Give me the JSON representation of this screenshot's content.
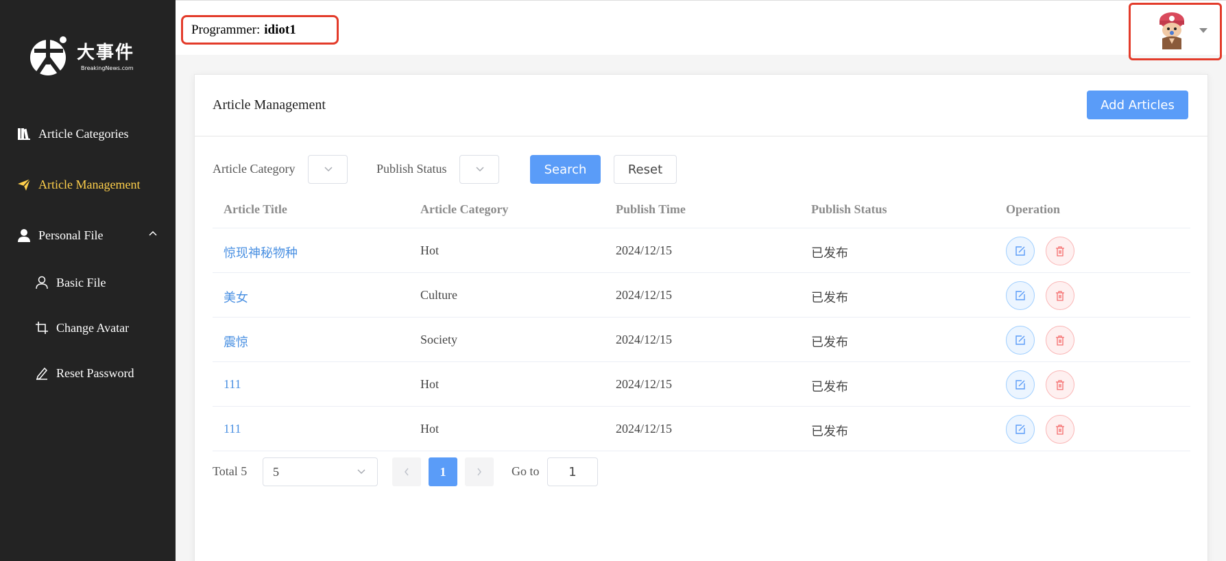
{
  "sidebar": {
    "logo": {
      "title": "大事件",
      "subtitle": "BreakingNews.com"
    },
    "items": [
      {
        "label": "Article Categories",
        "icon": "book-icon"
      },
      {
        "label": "Article Management",
        "icon": "send-icon",
        "active": true
      },
      {
        "label": "Personal File",
        "icon": "user-icon",
        "expanded": true
      },
      {
        "label": "Basic File",
        "icon": "user-outline-icon"
      },
      {
        "label": "Change Avatar",
        "icon": "crop-icon"
      },
      {
        "label": "Reset Password",
        "icon": "pen-icon"
      }
    ]
  },
  "header": {
    "programmer_label": "Programmer:",
    "programmer_name": "idiot1"
  },
  "card": {
    "title": "Article Management",
    "add_button": "Add Articles"
  },
  "filters": {
    "category_label": "Article Category",
    "status_label": "Publish Status",
    "search_button": "Search",
    "reset_button": "Reset"
  },
  "table": {
    "columns": [
      "Article Title",
      "Article Category",
      "Publish Time",
      "Publish Status",
      "Operation"
    ],
    "rows": [
      {
        "title": "惊现神秘物种",
        "category": "Hot",
        "time": "2024/12/15",
        "status": "已发布"
      },
      {
        "title": "美女",
        "category": "Culture",
        "time": "2024/12/15",
        "status": "已发布"
      },
      {
        "title": "震惊",
        "category": "Society",
        "time": "2024/12/15",
        "status": "已发布"
      },
      {
        "title": "111",
        "category": "Hot",
        "time": "2024/12/15",
        "status": "已发布"
      },
      {
        "title": "111",
        "category": "Hot",
        "time": "2024/12/15",
        "status": "已发布"
      }
    ]
  },
  "pagination": {
    "total_label": "Total 5",
    "page_size": "5",
    "current_page": "1",
    "goto_label": "Go to",
    "goto_value": "1"
  },
  "colors": {
    "sidebar_bg": "#232323",
    "active_nav": "#ffd04b",
    "primary": "#5a9cf8",
    "highlight_border": "#e33b2a"
  }
}
